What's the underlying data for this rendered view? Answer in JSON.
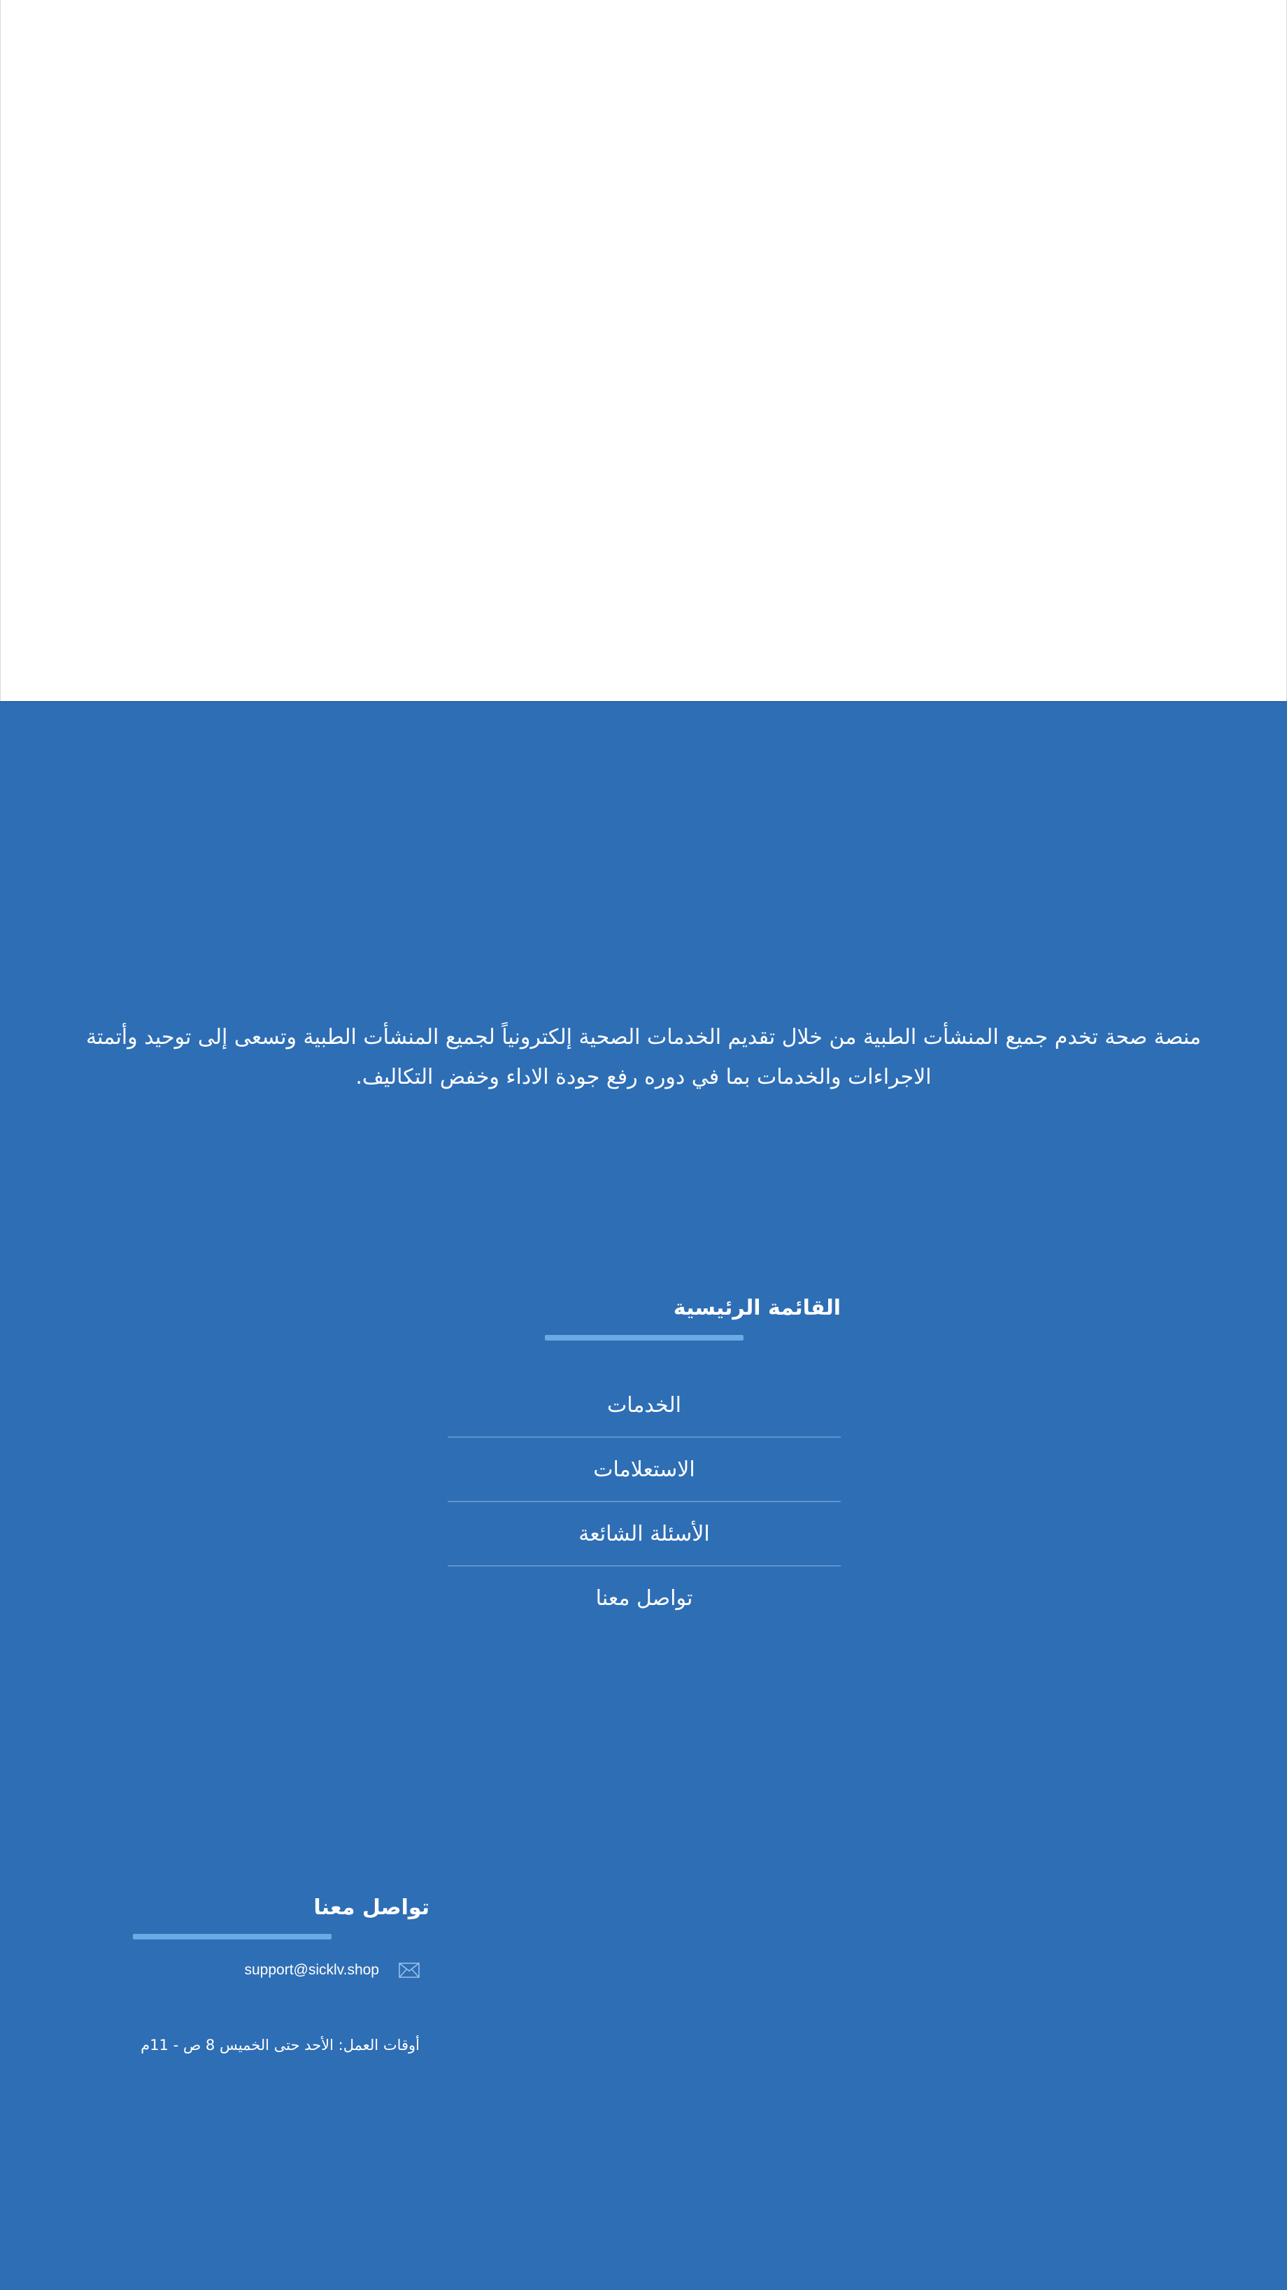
{
  "footer": {
    "about_text": "منصة صحة تخدم جميع المنشأت الطبية من خلال تقديم الخدمات الصحية إلكترونياً لجميع المنشأت الطبية وتسعى إلى توحيد وأتمتة الاجراءات والخدمات بما في دوره رفع جودة الاداء وخفض التكاليف.",
    "main_menu": {
      "title": "القائمة الرئيسية",
      "items": [
        {
          "label": "الخدمات"
        },
        {
          "label": "الاستعلامات"
        },
        {
          "label": "الأسئلة الشائعة"
        },
        {
          "label": "تواصل معنا"
        }
      ]
    },
    "contact": {
      "title": "تواصل معنا",
      "email": "support@sicklv.shop",
      "email_icon": "mail-icon",
      "hours": "أوقات العمل: الأحد حتى الخميس 8 ص - 11م"
    }
  },
  "colors": {
    "footer_background": "#2e6eb5",
    "underline_accent": "#6aaae5",
    "divider": "#5b93d0",
    "text": "#ffffff"
  }
}
